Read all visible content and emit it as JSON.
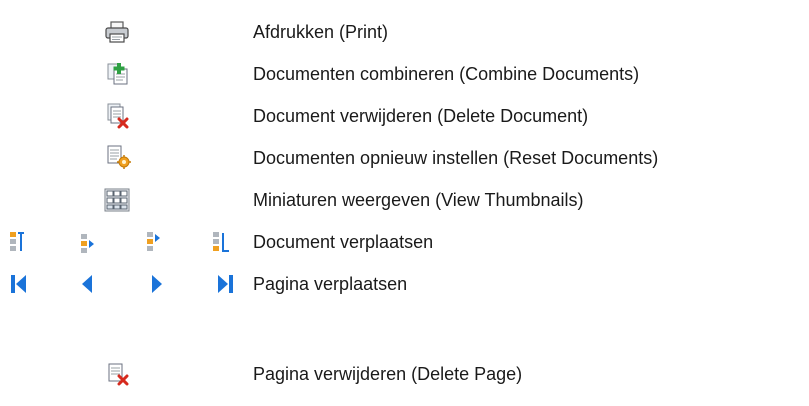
{
  "items": [
    {
      "label": "Afdrukken (Print)",
      "icon": "printer-icon"
    },
    {
      "label": "Documenten combineren (Combine Documents)",
      "icon": "combine-documents-icon"
    },
    {
      "label": "Document verwijderen (Delete Document)",
      "icon": "delete-document-icon"
    },
    {
      "label": "Documenten opnieuw instellen (Reset Documents)",
      "icon": "reset-documents-icon"
    },
    {
      "label": "Miniaturen weergeven (View Thumbnails)",
      "icon": "view-thumbnails-icon"
    },
    {
      "label": "Document verplaatsen",
      "icons": [
        "move-document-first-icon",
        "move-document-up-icon",
        "move-document-down-icon",
        "move-document-last-icon"
      ]
    },
    {
      "label": "Pagina verplaatsen",
      "icons": [
        "first-page-icon",
        "previous-page-icon",
        "next-page-icon",
        "last-page-icon"
      ]
    },
    {
      "label": "Pagina verwijderen (Delete Page)",
      "icon": "delete-page-icon"
    }
  ],
  "colors": {
    "accent_blue": "#1a73d9",
    "delete_red": "#d62a1e",
    "add_green": "#2ea043",
    "reset_orange": "#f0a020",
    "doc_gray": "#9aa0a6"
  }
}
